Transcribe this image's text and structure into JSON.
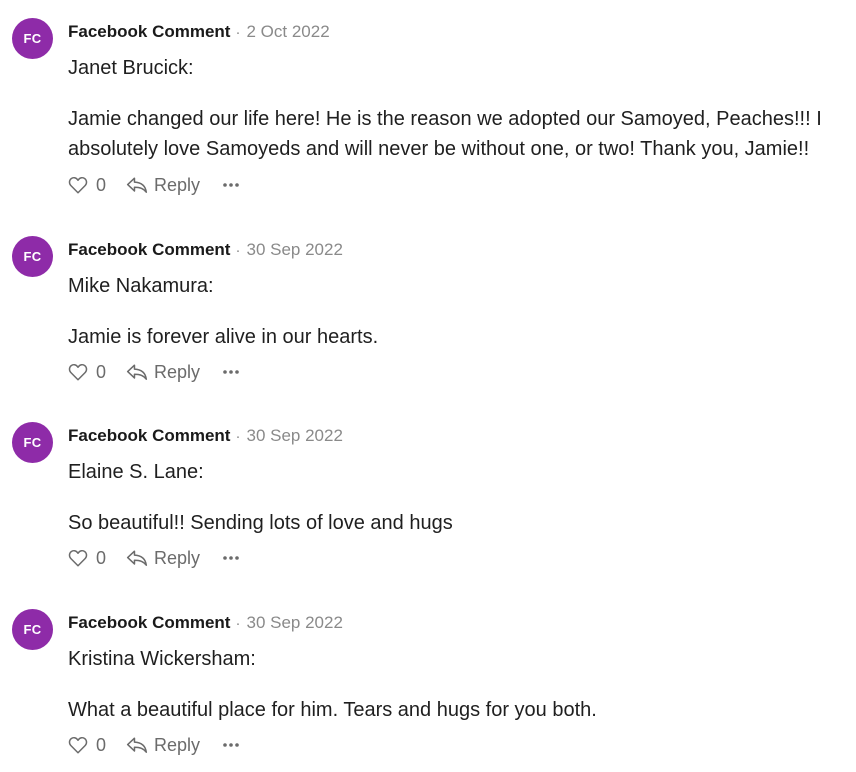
{
  "theme": {
    "avatar_color": "#8e2ba8",
    "text_color": "#1f1f1f",
    "muted_color": "#8a8a8a"
  },
  "comments": [
    {
      "avatar_initials": "FC",
      "author": "Facebook Comment",
      "separator": "·",
      "date": "2 Oct 2022",
      "name_line": "Janet Brucick:",
      "text": "Jamie changed our life here! He is the reason we adopted our Samoyed, Peaches!!! I absolutely love Samoyeds and will never be without one, or two! Thank you, Jamie!!",
      "like_icon": "heart-icon",
      "likes": "0",
      "reply_icon": "reply-arrow-icon",
      "reply_label": "Reply",
      "more_icon": "more-options-icon"
    },
    {
      "avatar_initials": "FC",
      "author": "Facebook Comment",
      "separator": "·",
      "date": "30 Sep 2022",
      "name_line": "Mike Nakamura:",
      "text": "Jamie is forever alive in our hearts.",
      "like_icon": "heart-icon",
      "likes": "0",
      "reply_icon": "reply-arrow-icon",
      "reply_label": "Reply",
      "more_icon": "more-options-icon"
    },
    {
      "avatar_initials": "FC",
      "author": "Facebook Comment",
      "separator": "·",
      "date": "30 Sep 2022",
      "name_line": "Elaine S. Lane:",
      "text": "So beautiful!! Sending lots of love and hugs",
      "like_icon": "heart-icon",
      "likes": "0",
      "reply_icon": "reply-arrow-icon",
      "reply_label": "Reply",
      "more_icon": "more-options-icon"
    },
    {
      "avatar_initials": "FC",
      "author": "Facebook Comment",
      "separator": "·",
      "date": "30 Sep 2022",
      "name_line": "Kristina Wickersham:",
      "text": "What a beautiful place for him. Tears and hugs for you both.",
      "like_icon": "heart-icon",
      "likes": "0",
      "reply_icon": "reply-arrow-icon",
      "reply_label": "Reply",
      "more_icon": "more-options-icon"
    }
  ]
}
